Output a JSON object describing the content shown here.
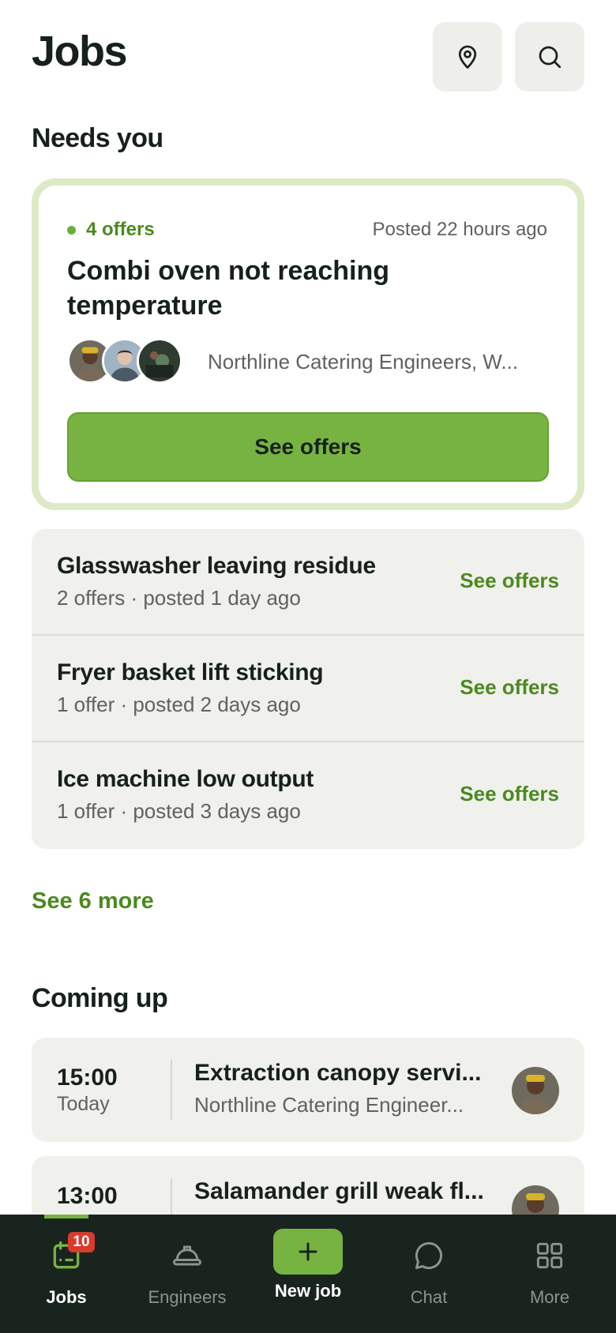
{
  "header": {
    "title": "Jobs"
  },
  "sections": {
    "needs_you": "Needs you",
    "coming_up": "Coming up"
  },
  "featured": {
    "offers": "4 offers",
    "posted": "Posted 22 hours ago",
    "title": "Combi oven not reaching temperature",
    "engineers": "Northline Catering Engineers, W...",
    "button": "See offers"
  },
  "offers_list": [
    {
      "title": "Glasswasher leaving residue",
      "meta": "2 offers · posted 1 day ago",
      "action": "See offers"
    },
    {
      "title": "Fryer basket lift sticking",
      "meta": "1 offer · posted 2 days ago",
      "action": "See offers"
    },
    {
      "title": "Ice machine low output",
      "meta": "1 offer · posted 3 days ago",
      "action": "See offers"
    }
  ],
  "see_more": "See 6 more",
  "upcoming": [
    {
      "time": "15:00",
      "day": "Today",
      "title": "Extraction canopy servi...",
      "subtitle": "Northline Catering Engineer..."
    },
    {
      "time": "13:00",
      "day": "",
      "title": "Salamander grill weak fl...",
      "subtitle": ""
    }
  ],
  "nav": {
    "jobs": "Jobs",
    "jobs_badge": "10",
    "engineers": "Engineers",
    "new_job": "New job",
    "chat": "Chat",
    "more": "More"
  },
  "colors": {
    "accent": "#77b341",
    "accent_text": "#4b8a1f",
    "badge": "#d93a2b",
    "nav_bg": "#19241e"
  }
}
